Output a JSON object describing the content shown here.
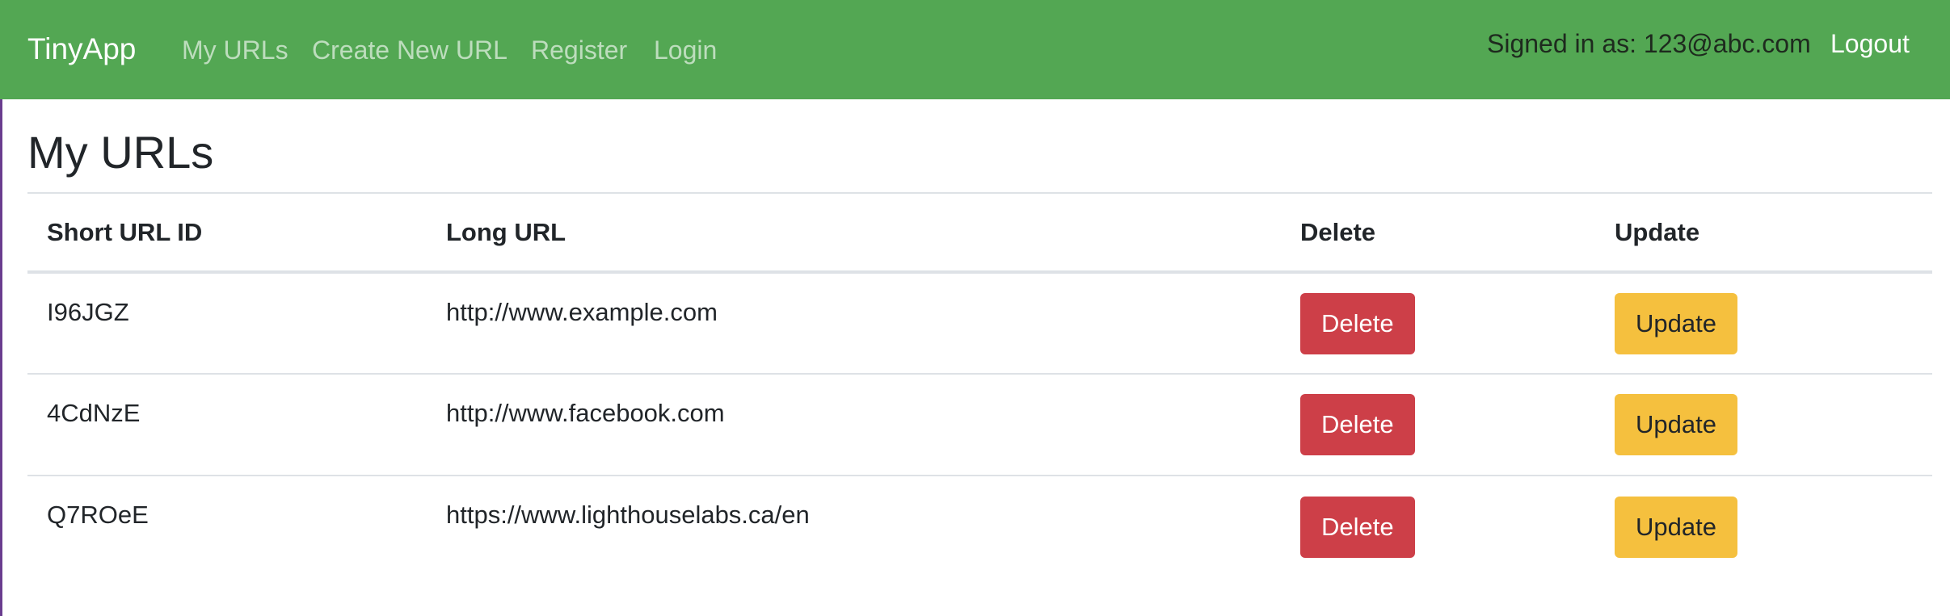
{
  "navbar": {
    "brand": "TinyApp",
    "links": [
      "My URLs",
      "Create New URL",
      "Register",
      "Login"
    ],
    "signed_in_text": "Signed in as: 123@abc.com",
    "logout_label": "Logout",
    "background_color": "#53a753"
  },
  "page": {
    "title": "My URLs"
  },
  "table": {
    "headers": [
      "Short URL ID",
      "Long URL",
      "Delete",
      "Update"
    ],
    "rows": [
      {
        "short_id": "I96JGZ",
        "long_url": "http://www.example.com",
        "delete_label": "Delete",
        "update_label": "Update"
      },
      {
        "short_id": "4CdNzE",
        "long_url": "http://www.facebook.com",
        "delete_label": "Delete",
        "update_label": "Update"
      },
      {
        "short_id": "Q7ROeE",
        "long_url": "https://www.lighthouselabs.ca/en",
        "delete_label": "Delete",
        "update_label": "Update"
      }
    ]
  },
  "colors": {
    "delete_button": "#cd3f48",
    "update_button": "#f5c03e"
  }
}
